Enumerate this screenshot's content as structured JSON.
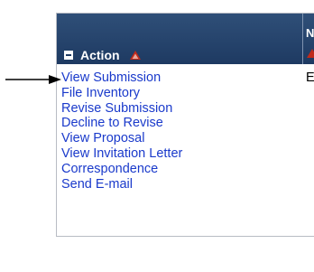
{
  "table": {
    "action_header": "Action",
    "next_column_header_partial": "N",
    "next_column_cell_partial": "E",
    "actions": [
      "View Submission",
      "File Inventory",
      "Revise Submission",
      "Decline to Revise",
      "View Proposal",
      "View Invitation Letter",
      "Correspondence",
      "Send E-mail"
    ]
  },
  "colors": {
    "header_bg": "#1e3a62",
    "link": "#1a3acb",
    "sort_icon": "#c02a1a"
  },
  "icons": {
    "collapse": "collapse-minus-icon",
    "sort": "sort-triangle-icon",
    "pointer": "arrow-pointer-icon"
  }
}
